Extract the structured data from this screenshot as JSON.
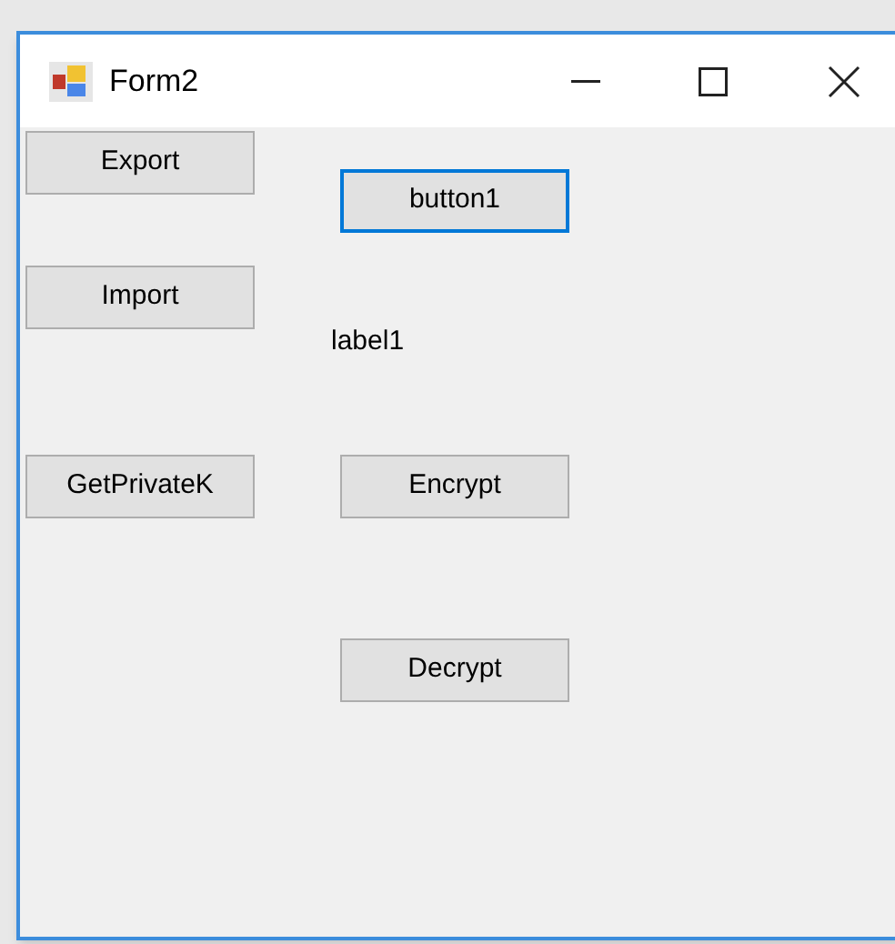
{
  "window": {
    "title": "Form2"
  },
  "controls": [
    {
      "kind": "button",
      "text": "Export",
      "focused": false
    },
    {
      "kind": "button",
      "text": "button1",
      "focused": true
    },
    {
      "kind": "button",
      "text": "Import",
      "focused": false
    },
    {
      "kind": "label",
      "text": "label1"
    },
    {
      "kind": "button",
      "text": "GetPrivateK",
      "focused": false
    },
    {
      "kind": "button",
      "text": "Encrypt",
      "focused": false
    },
    {
      "kind": "button",
      "text": "Decrypt",
      "focused": false
    }
  ]
}
